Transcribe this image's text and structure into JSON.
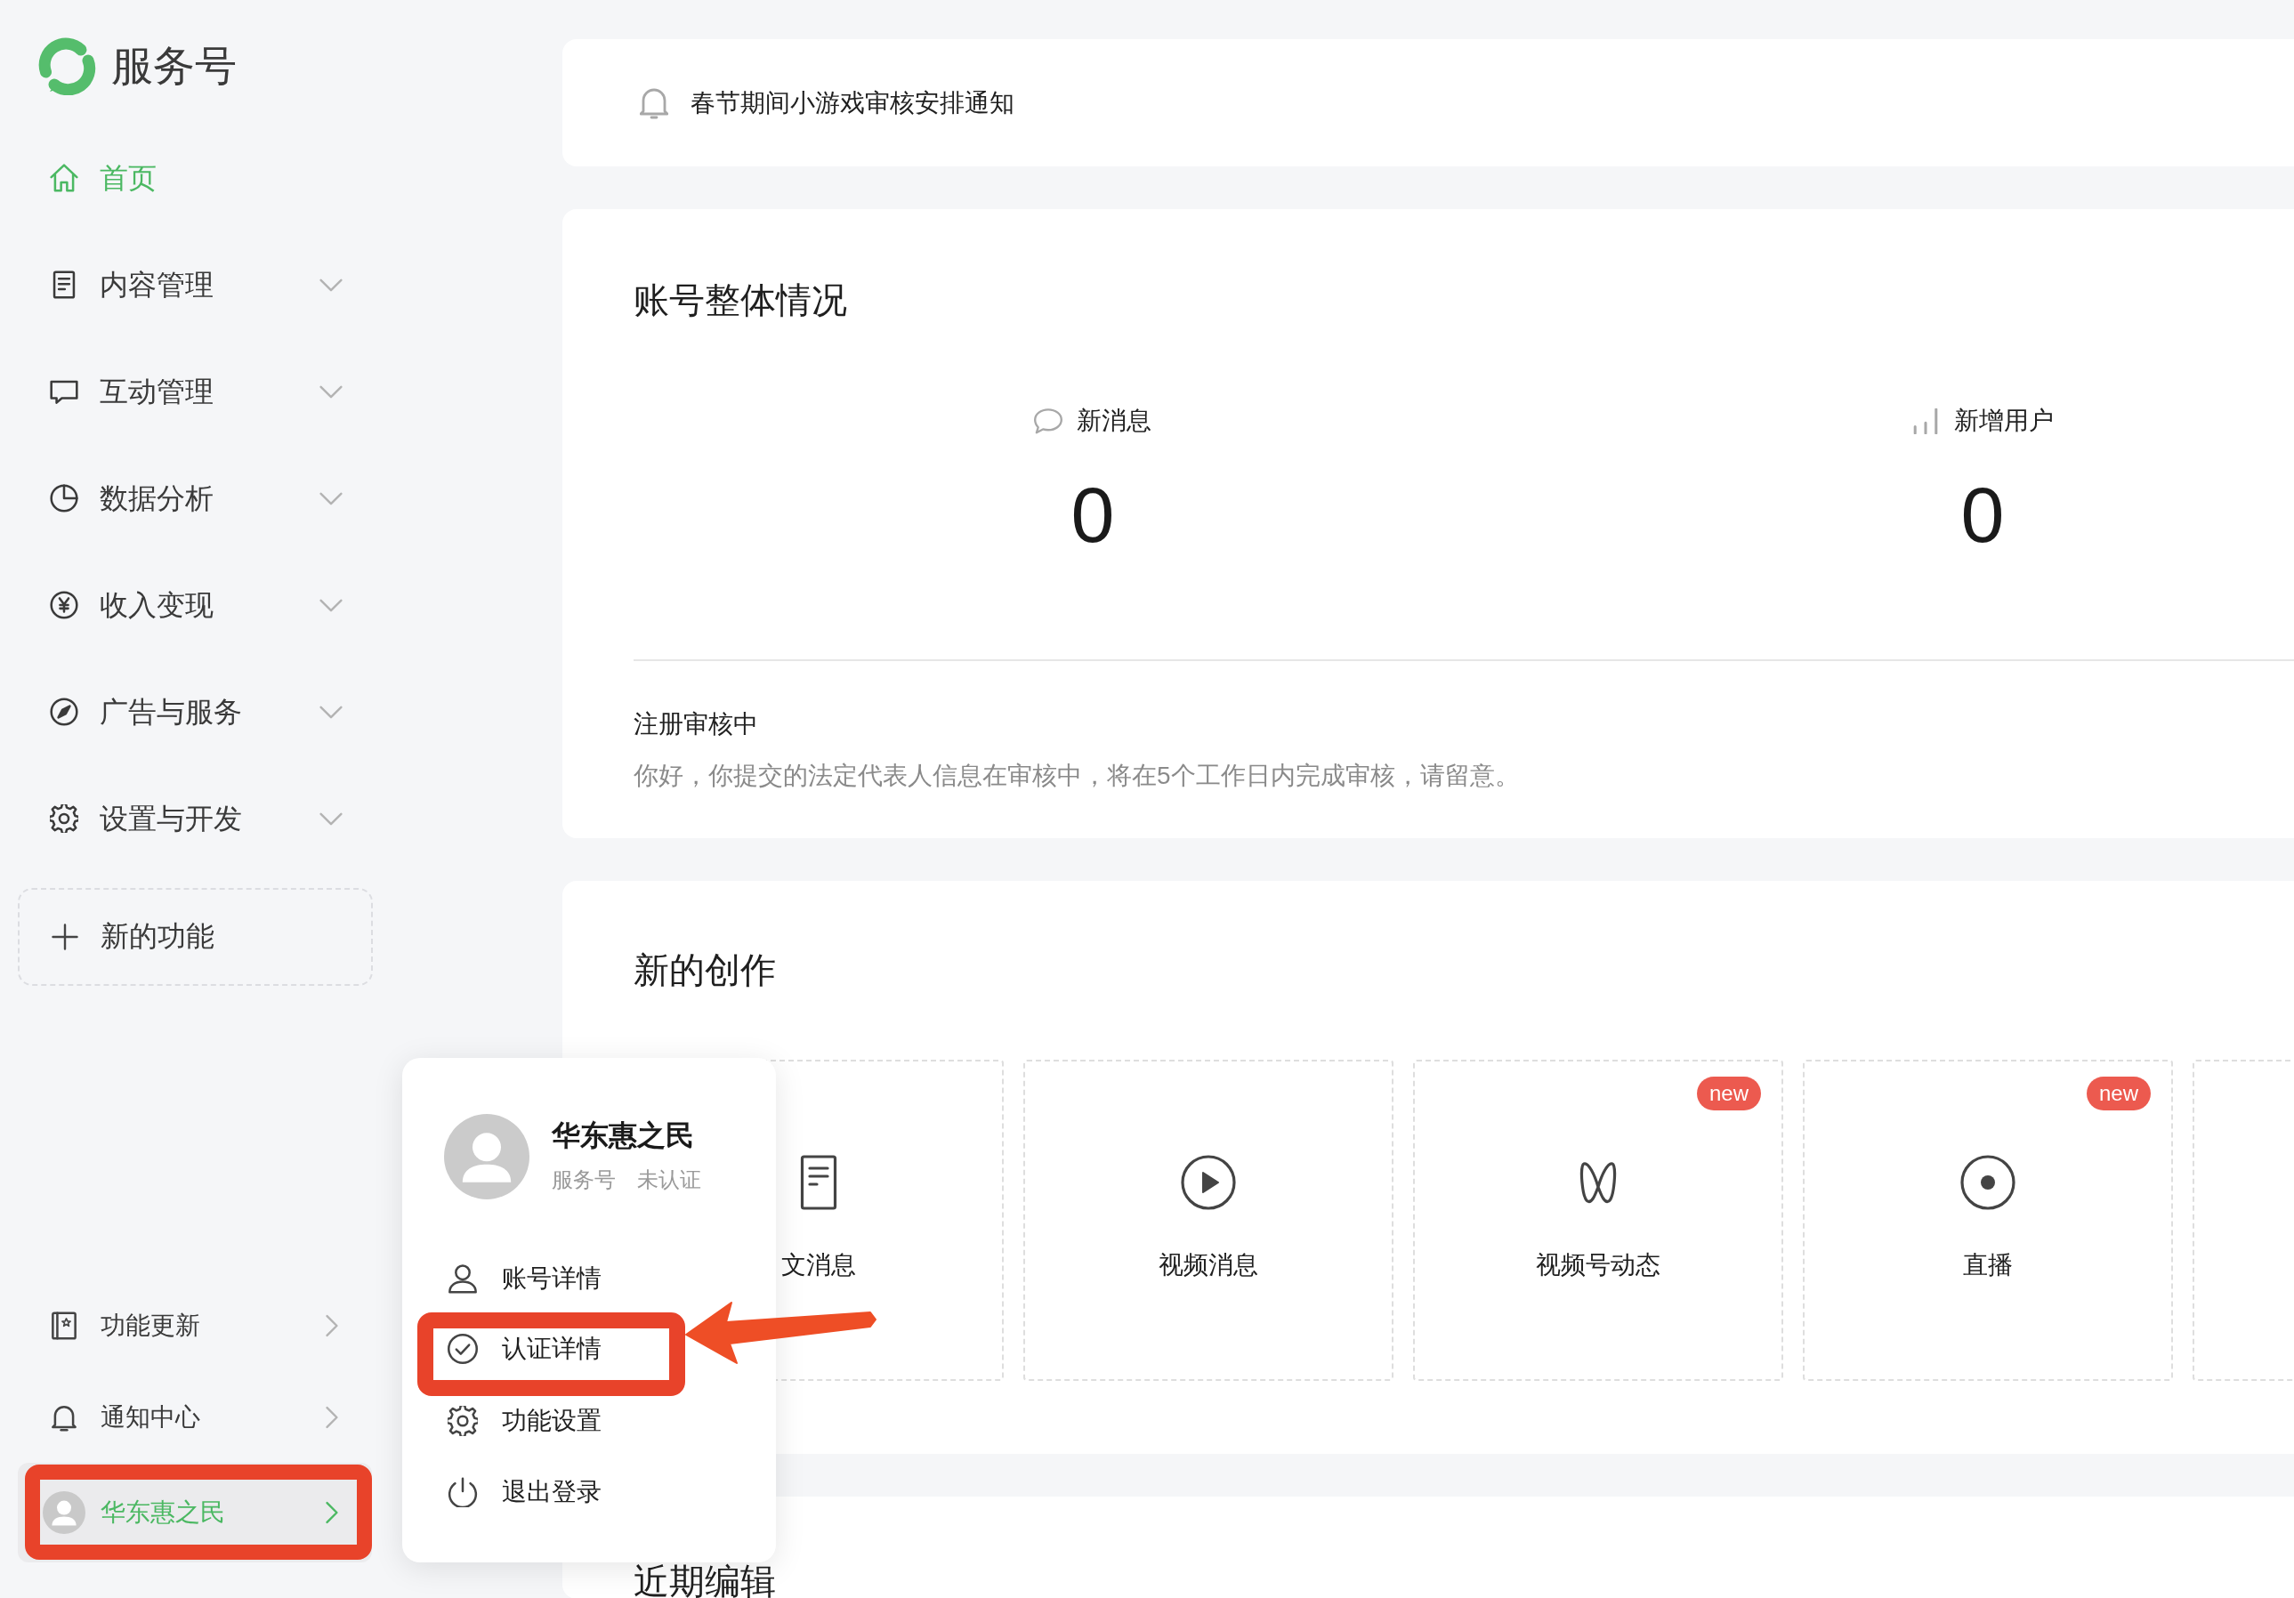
{
  "sidebar": {
    "logo": {
      "title": "服务号"
    },
    "nav": [
      {
        "kind": "home",
        "label": "首页",
        "selected": true,
        "expandable": false
      },
      {
        "kind": "content",
        "label": "内容管理",
        "selected": false,
        "expandable": true
      },
      {
        "kind": "interaction",
        "label": "互动管理",
        "selected": false,
        "expandable": true
      },
      {
        "kind": "analytics",
        "label": "数据分析",
        "selected": false,
        "expandable": true
      },
      {
        "kind": "income",
        "label": "收入变现",
        "selected": false,
        "expandable": true
      },
      {
        "kind": "ads",
        "label": "广告与服务",
        "selected": false,
        "expandable": true
      },
      {
        "kind": "settings",
        "label": "设置与开发",
        "selected": false,
        "expandable": true
      }
    ],
    "new_feature": {
      "label": "新的功能"
    },
    "bottom": [
      {
        "kind": "updates",
        "label": "功能更新"
      },
      {
        "kind": "notifications",
        "label": "通知中心"
      }
    ],
    "account": {
      "name": "华东惠之民",
      "selected": true,
      "highlighted": true
    }
  },
  "notice": {
    "text": "春节期间小游戏审核安排通知"
  },
  "overview": {
    "title": "账号整体情况",
    "stats": [
      {
        "kind": "messages",
        "label": "新消息",
        "value": "0"
      },
      {
        "kind": "users",
        "label": "新增用户",
        "value": "0"
      }
    ],
    "status": {
      "title": "注册审核中",
      "text": "你好，你提交的法定代表人信息在审核中，将在5个工作日内完成审核，请留意。"
    }
  },
  "creation": {
    "title": "新的创作",
    "tiles": [
      {
        "kind": "article",
        "label": "文消息"
      },
      {
        "kind": "video",
        "label": "视频消息"
      },
      {
        "kind": "channels",
        "label": "视频号动态",
        "badge": "new"
      },
      {
        "kind": "live",
        "label": "直播",
        "badge": "new"
      },
      {
        "kind": "blank"
      }
    ]
  },
  "recent": {
    "title": "近期编辑"
  },
  "account_menu": {
    "name": "华东惠之民",
    "type": "服务号",
    "verification": "未认证",
    "items": [
      {
        "kind": "account",
        "label": "账号详情",
        "highlighted": false,
        "arrow": false
      },
      {
        "kind": "certification",
        "label": "认证详情",
        "highlighted": true,
        "arrow": true
      },
      {
        "kind": "settings",
        "label": "功能设置",
        "highlighted": false,
        "arrow": false
      },
      {
        "kind": "logout",
        "label": "退出登录",
        "highlighted": false,
        "arrow": false
      }
    ]
  }
}
